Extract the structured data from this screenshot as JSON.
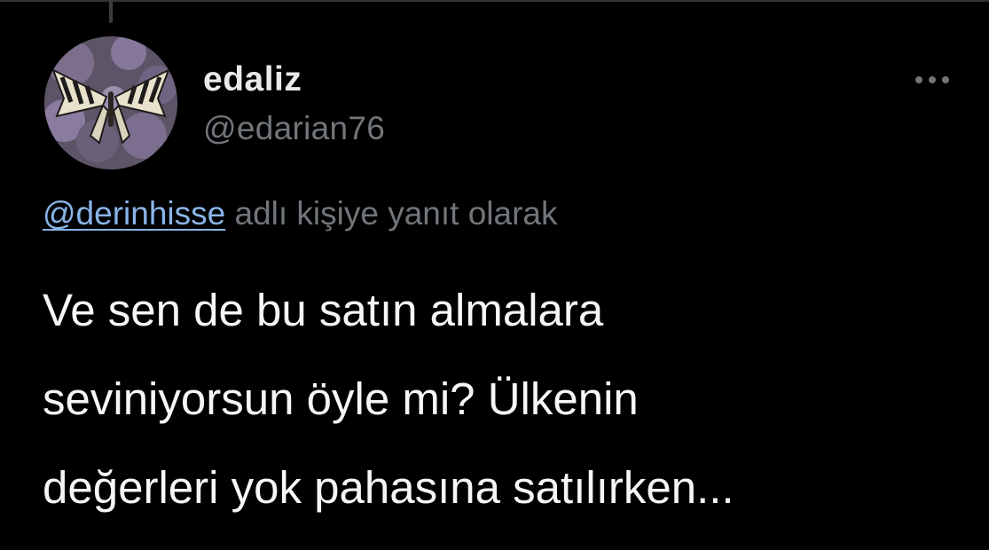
{
  "user": {
    "display_name": "edaliz",
    "handle": "@edarian76",
    "avatar_icon": "butterfly-avatar"
  },
  "reply": {
    "mention": "@derinhisse",
    "suffix": " adlı kişiye yanıt olarak"
  },
  "tweet": {
    "lines": [
      "Ve sen de bu satın almalara",
      "seviniyorsun öyle mi? Ülkenin",
      "değerleri yok pahasına satılırken..."
    ]
  },
  "menu": {
    "icon": "more-horizontal-icon"
  },
  "colors": {
    "background": "#000000",
    "primary_text": "#e7e9ea",
    "secondary_text": "#71767b",
    "mention": "#8ab4e8"
  }
}
